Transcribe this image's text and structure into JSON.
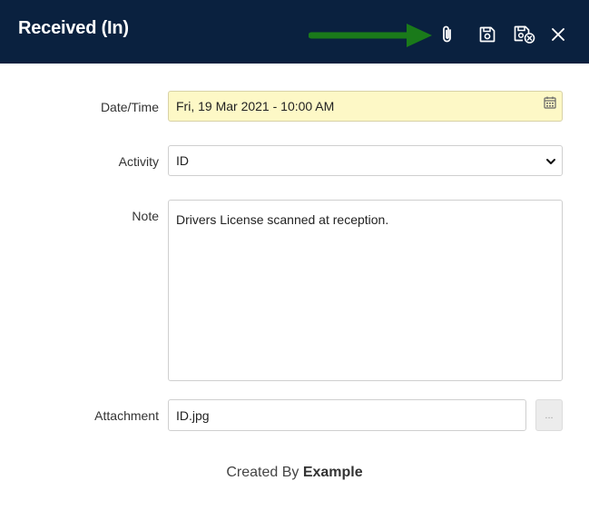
{
  "header": {
    "title": "Received (In)",
    "background_color": "#0a213f",
    "actions": [
      {
        "name": "attach",
        "icon": "paperclip-icon"
      },
      {
        "name": "save",
        "icon": "save-icon"
      },
      {
        "name": "save-close",
        "icon": "save-close-icon"
      },
      {
        "name": "close",
        "icon": "close-icon"
      }
    ],
    "annotation_arrow_color": "#1a7a1a"
  },
  "form": {
    "datetime": {
      "label": "Date/Time",
      "value": "Fri, 19 Mar 2021 - 10:00 AM",
      "icon": "calendar-icon",
      "background_color": "#fdf8c6"
    },
    "activity": {
      "label": "Activity",
      "value": "ID",
      "icon": "chevron-down-icon"
    },
    "note": {
      "label": "Note",
      "value": "Drivers License scanned at reception."
    },
    "attachment": {
      "label": "Attachment",
      "value": "ID.jpg",
      "browse_label": "..."
    }
  },
  "footer": {
    "created_by_label": "Created By",
    "created_by_name": "Example"
  }
}
